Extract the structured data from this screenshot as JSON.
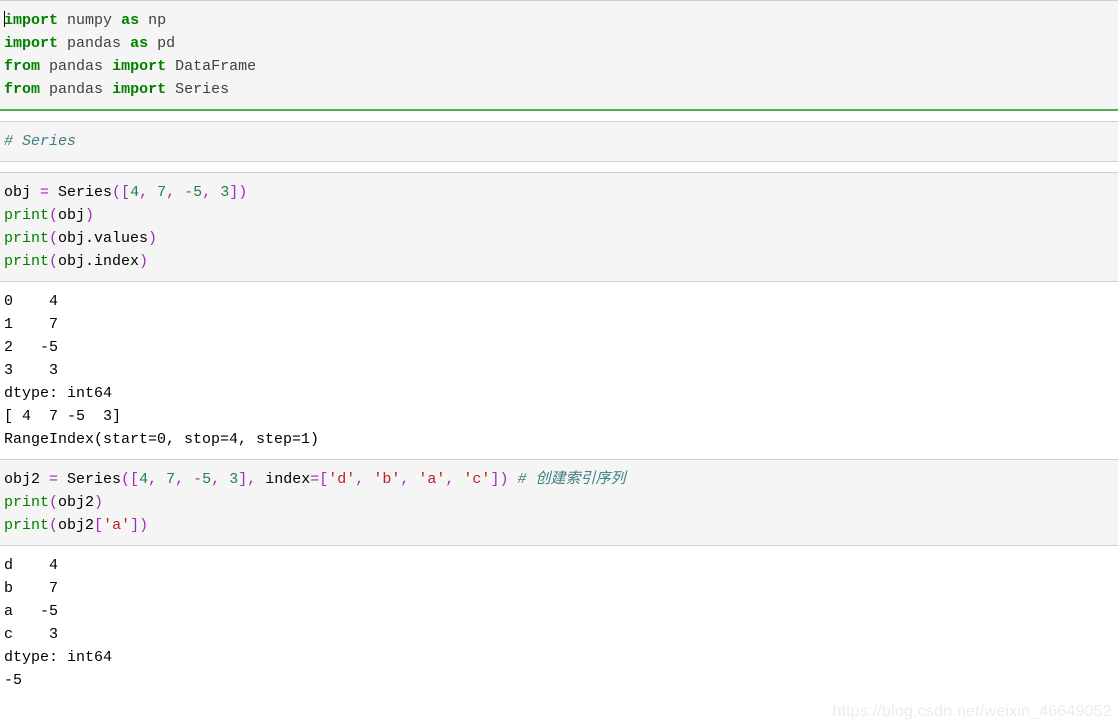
{
  "notebook": {
    "watermark": "https://blog.csdn.net/weixin_46649052",
    "colors": {
      "cell_background": "#f5f5f5",
      "output_background": "#ffffff",
      "cell_border": "#cfcfcf",
      "selected_border": "#4caf50",
      "keyword": "#008000",
      "number": "#208050",
      "operator": "#9b30b0",
      "string": "#ba2121",
      "comment": "#408080",
      "watermark": "#ececec"
    },
    "cells": [
      {
        "type": "code",
        "selected": true,
        "lines": [
          [
            {
              "t": "caret",
              "v": ""
            },
            {
              "t": "kw",
              "v": "import"
            },
            {
              "t": "plain",
              "v": " "
            },
            {
              "t": "name",
              "v": "numpy"
            },
            {
              "t": "plain",
              "v": " "
            },
            {
              "t": "kw",
              "v": "as"
            },
            {
              "t": "plain",
              "v": " "
            },
            {
              "t": "name",
              "v": "np"
            }
          ],
          [
            {
              "t": "kw",
              "v": "import"
            },
            {
              "t": "plain",
              "v": " "
            },
            {
              "t": "name",
              "v": "pandas"
            },
            {
              "t": "plain",
              "v": " "
            },
            {
              "t": "kw",
              "v": "as"
            },
            {
              "t": "plain",
              "v": " "
            },
            {
              "t": "name",
              "v": "pd"
            }
          ],
          [
            {
              "t": "kw",
              "v": "from"
            },
            {
              "t": "plain",
              "v": " "
            },
            {
              "t": "name",
              "v": "pandas"
            },
            {
              "t": "plain",
              "v": " "
            },
            {
              "t": "kw",
              "v": "import"
            },
            {
              "t": "plain",
              "v": " "
            },
            {
              "t": "name",
              "v": "DataFrame"
            }
          ],
          [
            {
              "t": "kw",
              "v": "from"
            },
            {
              "t": "plain",
              "v": " "
            },
            {
              "t": "name",
              "v": "pandas"
            },
            {
              "t": "plain",
              "v": " "
            },
            {
              "t": "kw",
              "v": "import"
            },
            {
              "t": "plain",
              "v": " "
            },
            {
              "t": "name",
              "v": "Series"
            }
          ]
        ],
        "output": null
      },
      {
        "type": "code",
        "selected": false,
        "lines": [
          [
            {
              "t": "comment",
              "v": "# Series"
            }
          ]
        ],
        "output": null
      },
      {
        "type": "code",
        "selected": false,
        "lines": [
          [
            {
              "t": "plain",
              "v": "obj "
            },
            {
              "t": "op",
              "v": "="
            },
            {
              "t": "plain",
              "v": " Series"
            },
            {
              "t": "op",
              "v": "(["
            },
            {
              "t": "num",
              "v": "4"
            },
            {
              "t": "op",
              "v": ","
            },
            {
              "t": "plain",
              "v": " "
            },
            {
              "t": "num",
              "v": "7"
            },
            {
              "t": "op",
              "v": ","
            },
            {
              "t": "plain",
              "v": " "
            },
            {
              "t": "op",
              "v": "-"
            },
            {
              "t": "num",
              "v": "5"
            },
            {
              "t": "op",
              "v": ","
            },
            {
              "t": "plain",
              "v": " "
            },
            {
              "t": "num",
              "v": "3"
            },
            {
              "t": "op",
              "v": "])"
            }
          ],
          [
            {
              "t": "builtin",
              "v": "print"
            },
            {
              "t": "op",
              "v": "("
            },
            {
              "t": "plain",
              "v": "obj"
            },
            {
              "t": "op",
              "v": ")"
            }
          ],
          [
            {
              "t": "builtin",
              "v": "print"
            },
            {
              "t": "op",
              "v": "("
            },
            {
              "t": "plain",
              "v": "obj.values"
            },
            {
              "t": "op",
              "v": ")"
            }
          ],
          [
            {
              "t": "builtin",
              "v": "print"
            },
            {
              "t": "op",
              "v": "("
            },
            {
              "t": "plain",
              "v": "obj.index"
            },
            {
              "t": "op",
              "v": ")"
            }
          ]
        ],
        "output": [
          "0    4",
          "1    7",
          "2   -5",
          "3    3",
          "dtype: int64",
          "[ 4  7 -5  3]",
          "RangeIndex(start=0, stop=4, step=1)"
        ]
      },
      {
        "type": "code",
        "selected": false,
        "lines": [
          [
            {
              "t": "plain",
              "v": "obj2 "
            },
            {
              "t": "op",
              "v": "="
            },
            {
              "t": "plain",
              "v": " Series"
            },
            {
              "t": "op",
              "v": "(["
            },
            {
              "t": "num",
              "v": "4"
            },
            {
              "t": "op",
              "v": ","
            },
            {
              "t": "plain",
              "v": " "
            },
            {
              "t": "num",
              "v": "7"
            },
            {
              "t": "op",
              "v": ","
            },
            {
              "t": "plain",
              "v": " "
            },
            {
              "t": "op",
              "v": "-"
            },
            {
              "t": "num",
              "v": "5"
            },
            {
              "t": "op",
              "v": ","
            },
            {
              "t": "plain",
              "v": " "
            },
            {
              "t": "num",
              "v": "3"
            },
            {
              "t": "op",
              "v": "],"
            },
            {
              "t": "plain",
              "v": " index"
            },
            {
              "t": "op",
              "v": "=["
            },
            {
              "t": "str",
              "v": "'d'"
            },
            {
              "t": "op",
              "v": ","
            },
            {
              "t": "plain",
              "v": " "
            },
            {
              "t": "str",
              "v": "'b'"
            },
            {
              "t": "op",
              "v": ","
            },
            {
              "t": "plain",
              "v": " "
            },
            {
              "t": "str",
              "v": "'a'"
            },
            {
              "t": "op",
              "v": ","
            },
            {
              "t": "plain",
              "v": " "
            },
            {
              "t": "str",
              "v": "'c'"
            },
            {
              "t": "op",
              "v": "])"
            },
            {
              "t": "plain",
              "v": " "
            },
            {
              "t": "comment",
              "v": "# 创建索引序列"
            }
          ],
          [
            {
              "t": "builtin",
              "v": "print"
            },
            {
              "t": "op",
              "v": "("
            },
            {
              "t": "plain",
              "v": "obj2"
            },
            {
              "t": "op",
              "v": ")"
            }
          ],
          [
            {
              "t": "builtin",
              "v": "print"
            },
            {
              "t": "op",
              "v": "("
            },
            {
              "t": "plain",
              "v": "obj2"
            },
            {
              "t": "op",
              "v": "["
            },
            {
              "t": "str",
              "v": "'a'"
            },
            {
              "t": "op",
              "v": "])"
            }
          ]
        ],
        "output": [
          "d    4",
          "b    7",
          "a   -5",
          "c    3",
          "dtype: int64",
          "-5"
        ]
      }
    ]
  }
}
